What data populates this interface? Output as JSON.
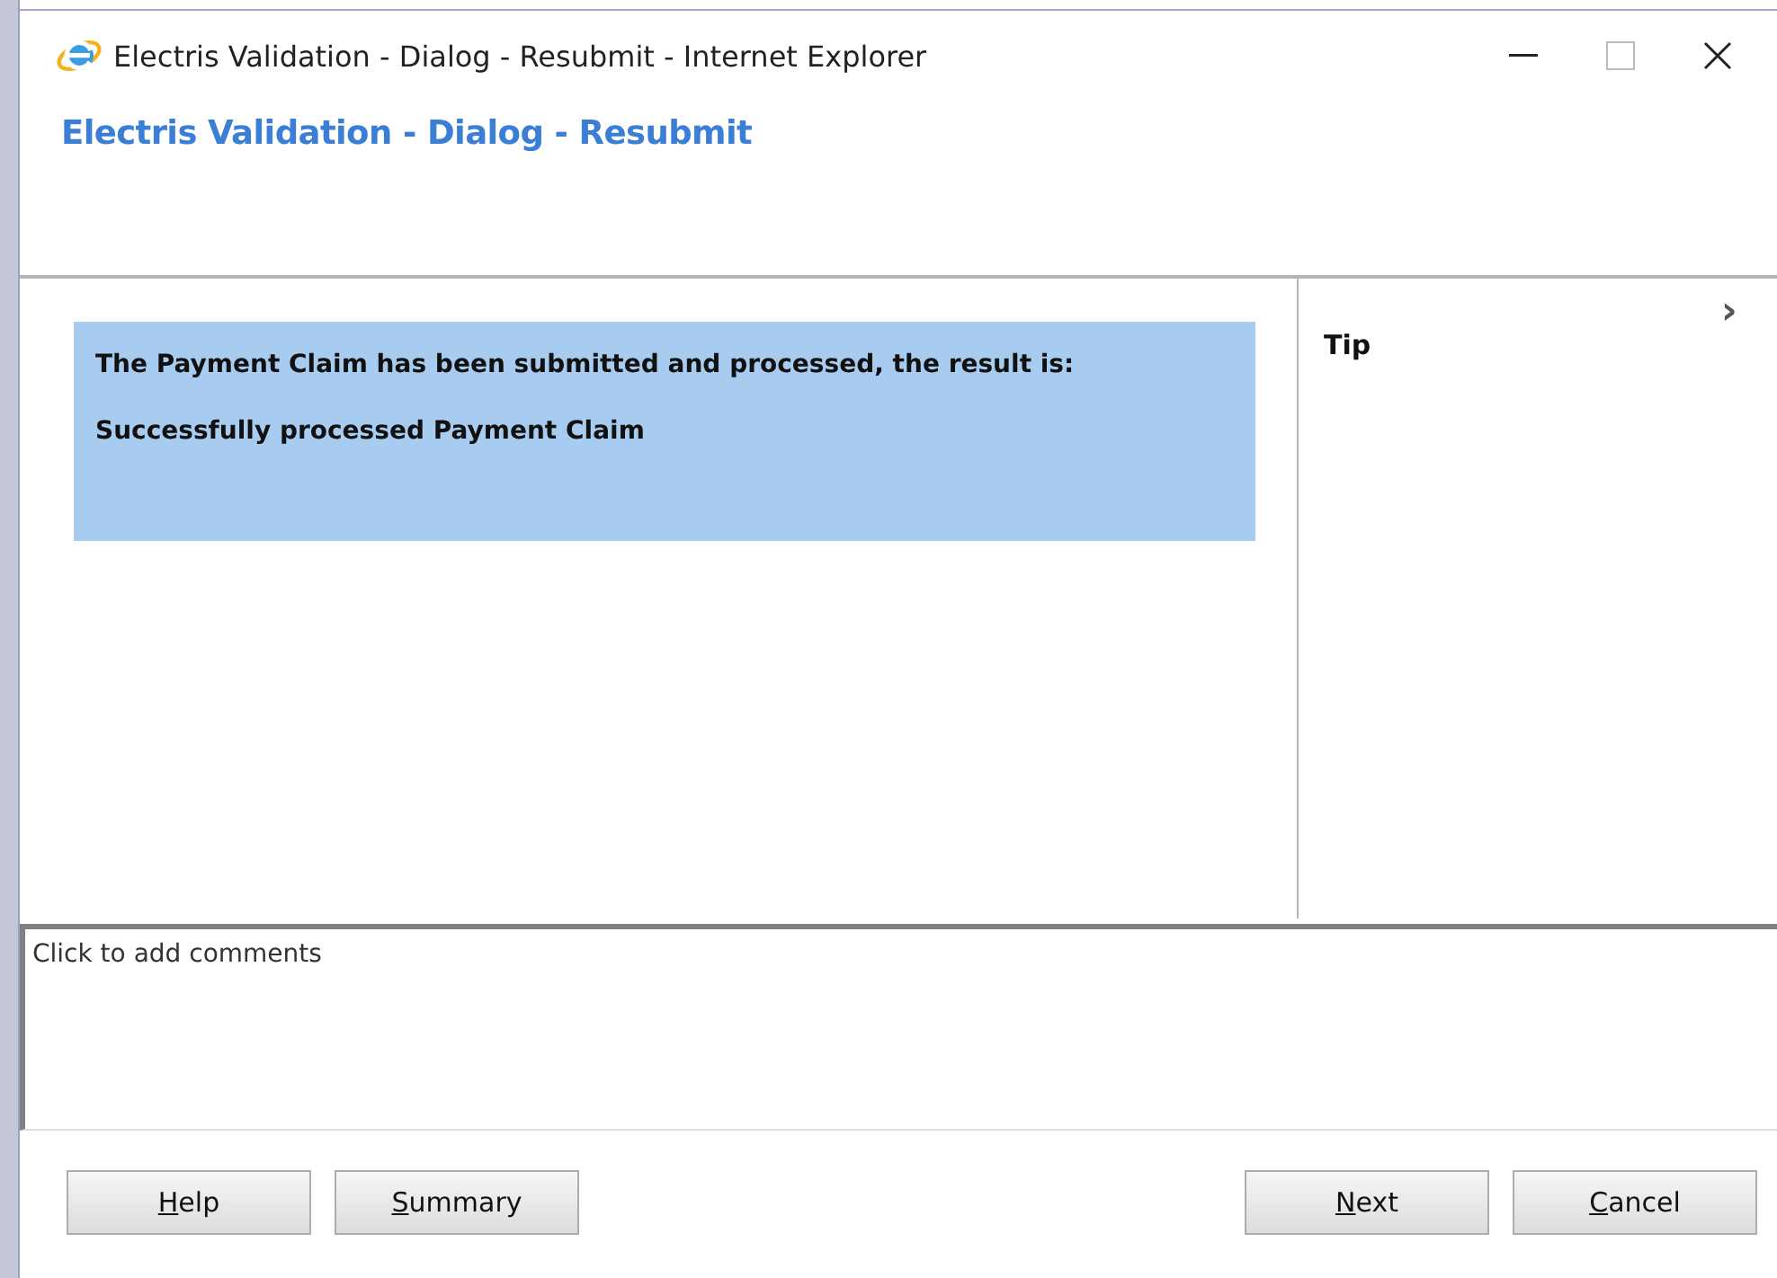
{
  "window": {
    "title": "Electris Validation - Dialog - Resubmit - Internet Explorer"
  },
  "dialog": {
    "heading": "Electris Validation - Dialog - Resubmit"
  },
  "message": {
    "lines": [
      "The Payment Claim has been submitted and processed, the result is:",
      "Successfully processed Payment Claim"
    ]
  },
  "tip_panel": {
    "title": "Tip",
    "expand_glyph": "›"
  },
  "comments": {
    "placeholder": "Click to add comments"
  },
  "left_buttons": [
    {
      "label": "Help",
      "mnemonic": true
    },
    {
      "label": "Summary",
      "mnemonic": true
    }
  ],
  "right_buttons": [
    {
      "label": "Next",
      "mnemonic": true
    },
    {
      "label": "Cancel",
      "mnemonic": true
    }
  ]
}
